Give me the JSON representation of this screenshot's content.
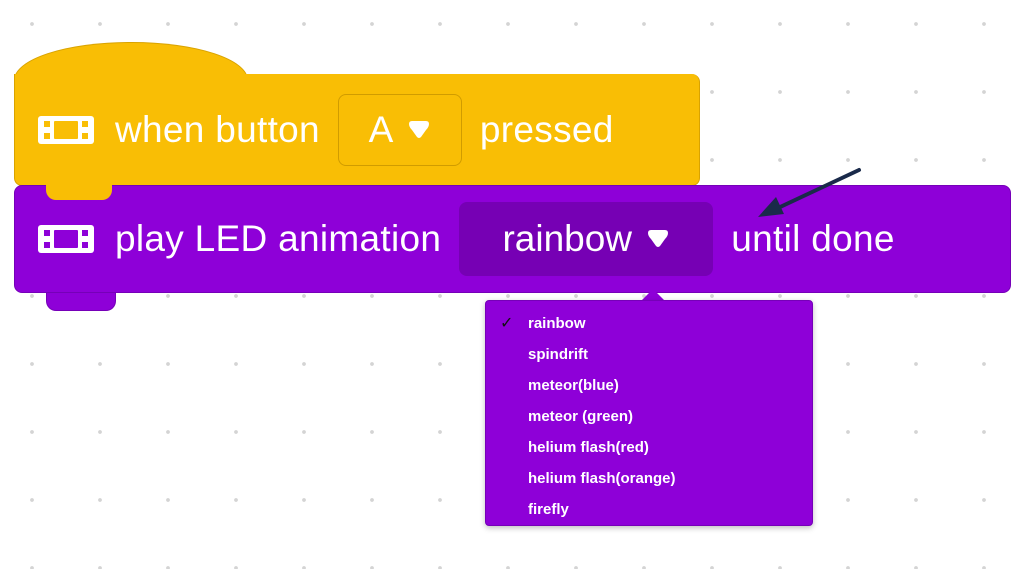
{
  "hat_block": {
    "icon": "led-device-icon",
    "text_before": "when button",
    "dropdown_value": "A",
    "text_after": "pressed",
    "color": "#f9be05"
  },
  "stack_block": {
    "icon": "led-device-icon",
    "text_before": "play LED animation",
    "dropdown_value": "rainbow",
    "text_after": "until done",
    "color": "#8e00d8"
  },
  "dropdown_menu": {
    "selected": "rainbow",
    "check_mark": "✓",
    "items": [
      {
        "label": "rainbow"
      },
      {
        "label": "spindrift"
      },
      {
        "label": "meteor(blue)"
      },
      {
        "label": "meteor (green)"
      },
      {
        "label": "helium flash(red)"
      },
      {
        "label": "helium flash(orange)"
      },
      {
        "label": "firefly"
      }
    ]
  },
  "annotation": {
    "icon": "pointer-arrow-icon",
    "color": "#1a2a4a"
  }
}
